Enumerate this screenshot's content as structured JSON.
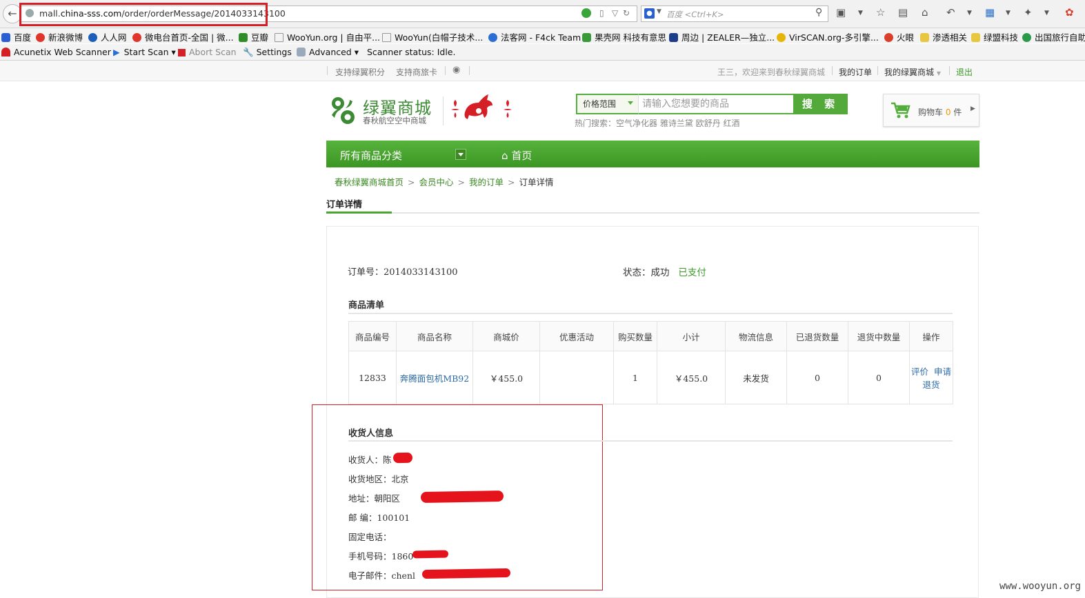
{
  "browser": {
    "url_prefix": "mall.",
    "url_domain": "china-sss.com",
    "url_path": "/order/orderMessage/2014033143100",
    "search_placeholder": "百度 <Ctrl+K>"
  },
  "bookmarks": [
    {
      "label": "百度",
      "color": "#2a5fd4"
    },
    {
      "label": "新浪微博",
      "color": "#e0352b"
    },
    {
      "label": "人人网",
      "color": "#1d5eb8"
    },
    {
      "label": "微电台首页-全国 | 微...",
      "color": "#e0352b"
    },
    {
      "label": "豆瓣",
      "color": "#2f8c26"
    },
    {
      "label": "WooYun.org | 自由平...",
      "color": "#ffffff"
    },
    {
      "label": "WooYun(白帽子技术...",
      "color": "#ffffff"
    },
    {
      "label": "法客网 - F4ck Team",
      "color": "#2a6fd1"
    },
    {
      "label": "果壳网 科技有意思",
      "color": "#3a9a3a"
    },
    {
      "label": "周边 | ZEALER—独立...",
      "color": "#1d3d8a"
    },
    {
      "label": "VirSCAN.org-多引擎...",
      "color": "#e7b50a"
    },
    {
      "label": "火眼",
      "color": "#d8402b"
    },
    {
      "label": "渗透相关",
      "color": "#e8c640"
    },
    {
      "label": "绿盟科技",
      "color": "#e8c640"
    },
    {
      "label": "出国旅行自助",
      "color": "#2a9a4a"
    }
  ],
  "acunetix": {
    "brand": "Acunetix Web Scanner",
    "start": "Start Scan",
    "abort": "Abort Scan",
    "settings": "Settings",
    "advanced": "Advanced",
    "status": "Scanner status: Idle."
  },
  "site_top": {
    "support_points": "支持绿翼积分",
    "support_card": "支持商旅卡",
    "welcome": "王三，欢迎来到春秋绿翼商城",
    "my_orders": "我的订单",
    "my_mall": "我的绿翼商城",
    "logout": "退出"
  },
  "header": {
    "logo_title": "绿翼商城",
    "logo_sub": "春秋航空空中商城",
    "price_range": "价格范围",
    "search_placeholder": "请输入您想要的商品",
    "search_button": "搜 索",
    "hot_search": "热门搜索：空气净化器 雅诗兰黛 欧舒丹 红酒",
    "cart_label": "购物车",
    "cart_count": "0",
    "cart_unit": "件"
  },
  "nav": {
    "all_categories": "所有商品分类",
    "home": "首页"
  },
  "breadcrumb": [
    "春秋绿翼商城首页",
    "会员中心",
    "我的订单",
    "订单详情"
  ],
  "page": {
    "tab": "订单详情",
    "order_label": "订单号：",
    "order_no": "2014033143100",
    "status_label": "状态：成功",
    "status_paid": "已支付",
    "items_title": "商品清单"
  },
  "items_table": {
    "headers": [
      "商品编号",
      "商品名称",
      "商城价",
      "优惠活动",
      "购买数量",
      "小计",
      "物流信息",
      "已退货数量",
      "退货中数量",
      "操作"
    ],
    "rows": [
      {
        "id": "12833",
        "name": "奔腾面包机MB92",
        "price": "￥455.0",
        "promo": "",
        "qty": "1",
        "subtotal": "￥455.0",
        "logistics": "未发货",
        "returned": "0",
        "returning": "0",
        "action_review": "评价",
        "action_return": "申请退货"
      }
    ]
  },
  "consignee": {
    "title": "收货人信息",
    "name": "收货人：陈",
    "region": "收货地区：北京",
    "address": "地址：朝阳区",
    "postcode": "邮 编：100101",
    "phone": "固定电话：",
    "mobile": "手机号码：1860",
    "email": "电子邮件：chenl"
  },
  "watermark": "www.wooyun.org",
  "colors": {
    "accent_green": "#4aa532",
    "highlight_red": "#d51f26",
    "link_blue": "#2b6aa8"
  }
}
